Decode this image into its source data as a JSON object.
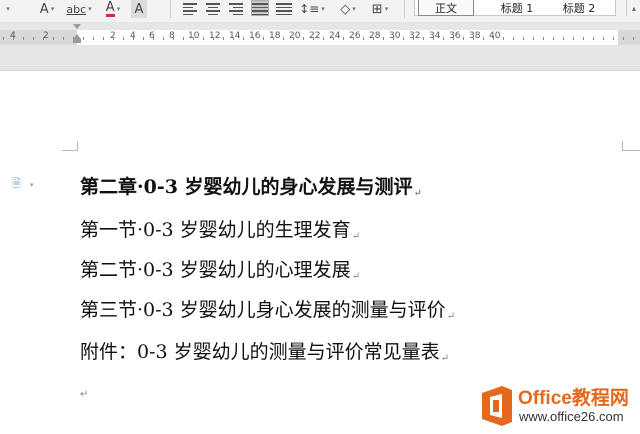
{
  "ribbon": {
    "icons": [
      "clear-format-icon",
      "phonetic-icon",
      "font-color-icon",
      "char-shading-icon",
      "align-left-icon",
      "align-center-icon",
      "align-right-icon",
      "justify-icon",
      "distributed-icon",
      "line-spacing-icon",
      "shading-icon",
      "borders-icon"
    ],
    "char_shading_glyph": "A",
    "font_color_glyph": "A",
    "phonetic_glyph": "abc",
    "clear_glyph": "A",
    "styles": [
      {
        "label": "正文",
        "active": true
      },
      {
        "label": "标题 1",
        "active": false
      },
      {
        "label": "标题 2",
        "active": false
      }
    ]
  },
  "ruler": {
    "numbers": [
      "4",
      "2",
      "2",
      "4",
      "6",
      "8",
      "10",
      "12",
      "14",
      "16",
      "18",
      "20",
      "22",
      "24",
      "26",
      "28",
      "30",
      "32",
      "34",
      "36",
      "38",
      "40"
    ]
  },
  "document": {
    "lines": [
      {
        "text": "第二章·0-3 岁婴幼儿的身心发展与测评",
        "bold": true
      },
      {
        "text": "第一节·0-3 岁婴幼儿的生理发育",
        "bold": false
      },
      {
        "text": "第二节·0-3 岁婴幼儿的心理发展",
        "bold": false
      },
      {
        "text": "第三节·0-3 岁婴幼儿身心发展的测量与评价",
        "bold": false
      },
      {
        "text": "附件：0-3 岁婴幼儿的测量与评价常见量表",
        "bold": false
      }
    ],
    "paragraph_mark": "↵"
  },
  "watermark": {
    "title": "Office教程网",
    "url": "www.office26.com"
  },
  "colors": {
    "accent_orange": "#e5691c",
    "ruler_margin": "#d8d8d8",
    "ribbon_bg": "#f3f3f3"
  }
}
